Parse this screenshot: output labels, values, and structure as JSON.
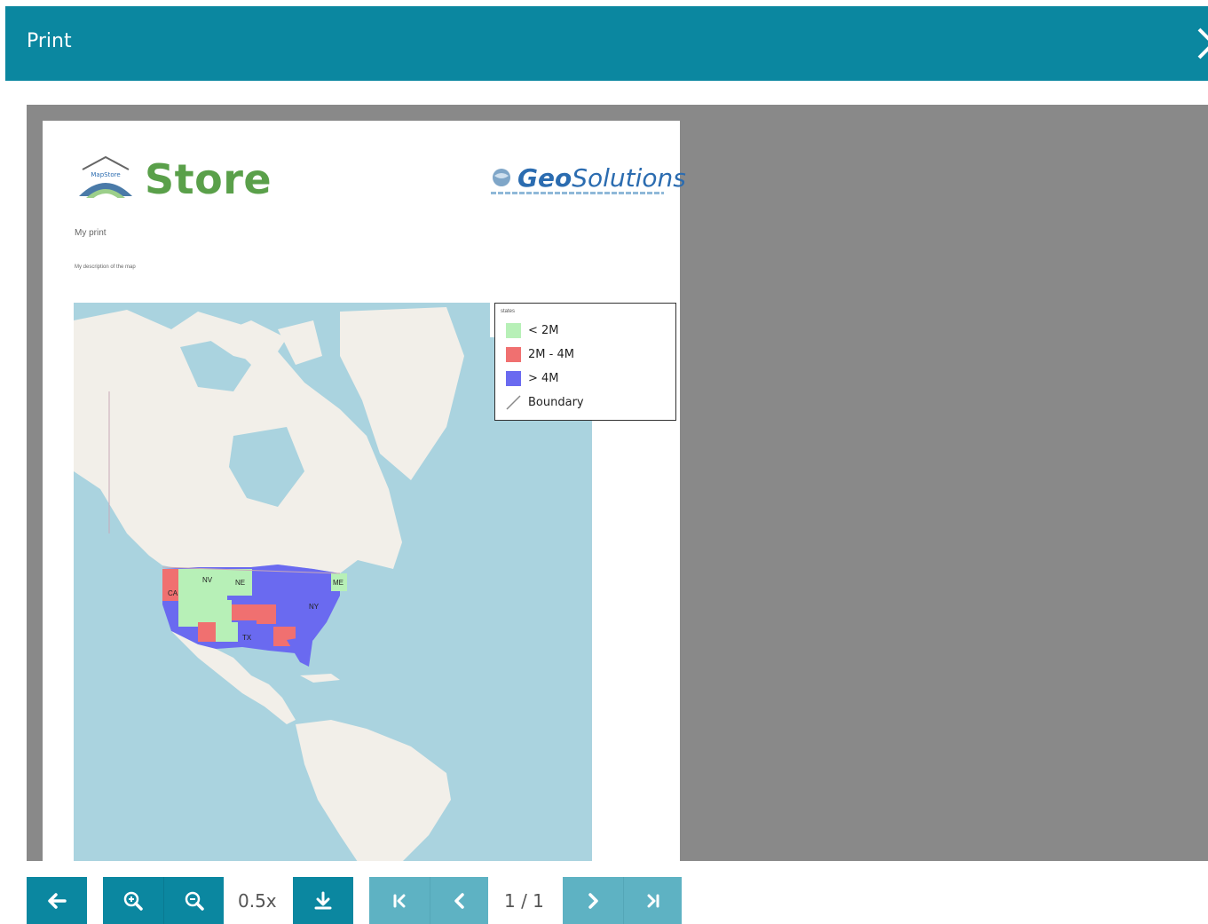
{
  "header": {
    "title": "Print"
  },
  "document": {
    "logo_left": {
      "part1": "Map",
      "part2": "Store",
      "badge": "MapStore"
    },
    "logo_right": {
      "part1": "Geo",
      "part2": "Solutions"
    },
    "title": "My print",
    "description": "My description of the map",
    "map_labels": [
      "NV",
      "CA",
      "NE",
      "TX",
      "ME",
      "NY"
    ],
    "legend": {
      "title": "states",
      "items": [
        {
          "label": "< 2M",
          "color": "#b7f0b7"
        },
        {
          "label": "2M - 4M",
          "color": "#f07070"
        },
        {
          "label": "> 4M",
          "color": "#6a6af0"
        },
        {
          "label": "Boundary",
          "color": "#888888"
        }
      ]
    }
  },
  "toolbar": {
    "zoom_level": "0.5x",
    "page_indicator": "1 / 1"
  },
  "colors": {
    "primary": "#0b87a0",
    "disabled": "#5eb2c3",
    "viewer_bg": "#898989",
    "sea": "#aad3df",
    "land": "#f2efe9"
  }
}
